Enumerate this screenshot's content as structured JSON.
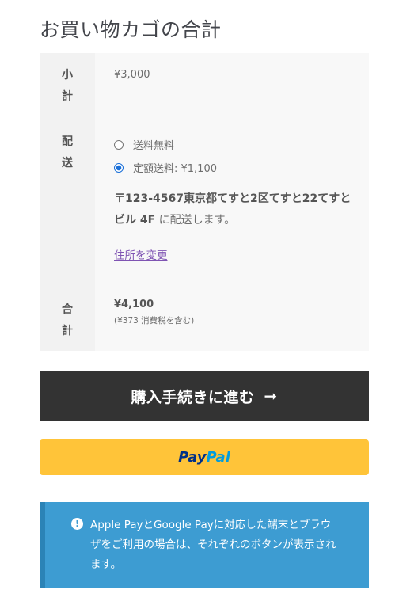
{
  "page": {
    "title": "お買い物カゴの合計"
  },
  "totals": {
    "subtotal": {
      "label": "小計",
      "value": "¥3,000"
    },
    "shipping": {
      "label": "配送",
      "options": [
        {
          "label": "送料無料",
          "selected": false
        },
        {
          "label": "定額送料: ¥1,100",
          "selected": true
        }
      ],
      "destination_address": "〒123-4567東京都てすと2区てすと22てすとビル 4F",
      "destination_suffix": " に配送します。",
      "change_address": "住所を変更"
    },
    "total": {
      "label": "合計",
      "value": "¥4,100",
      "tax_note": "(¥373 消費税を含む)"
    }
  },
  "checkout": {
    "label": "購入手続きに進む",
    "arrow": "➞"
  },
  "paypal": {
    "part1": "Pay",
    "part2": "Pal"
  },
  "notice": {
    "icon": "!",
    "text": "Apple PayとGoogle Payに対応した端末とブラウザをご利用の場合は、それぞれのボタンが表示されます。"
  },
  "colors": {
    "checkout_bg": "#333333",
    "paypal_bg": "#ffc439",
    "notice_bg": "#3d9cd2",
    "link": "#7f54b3",
    "radio_selected": "#1a6fd8"
  }
}
